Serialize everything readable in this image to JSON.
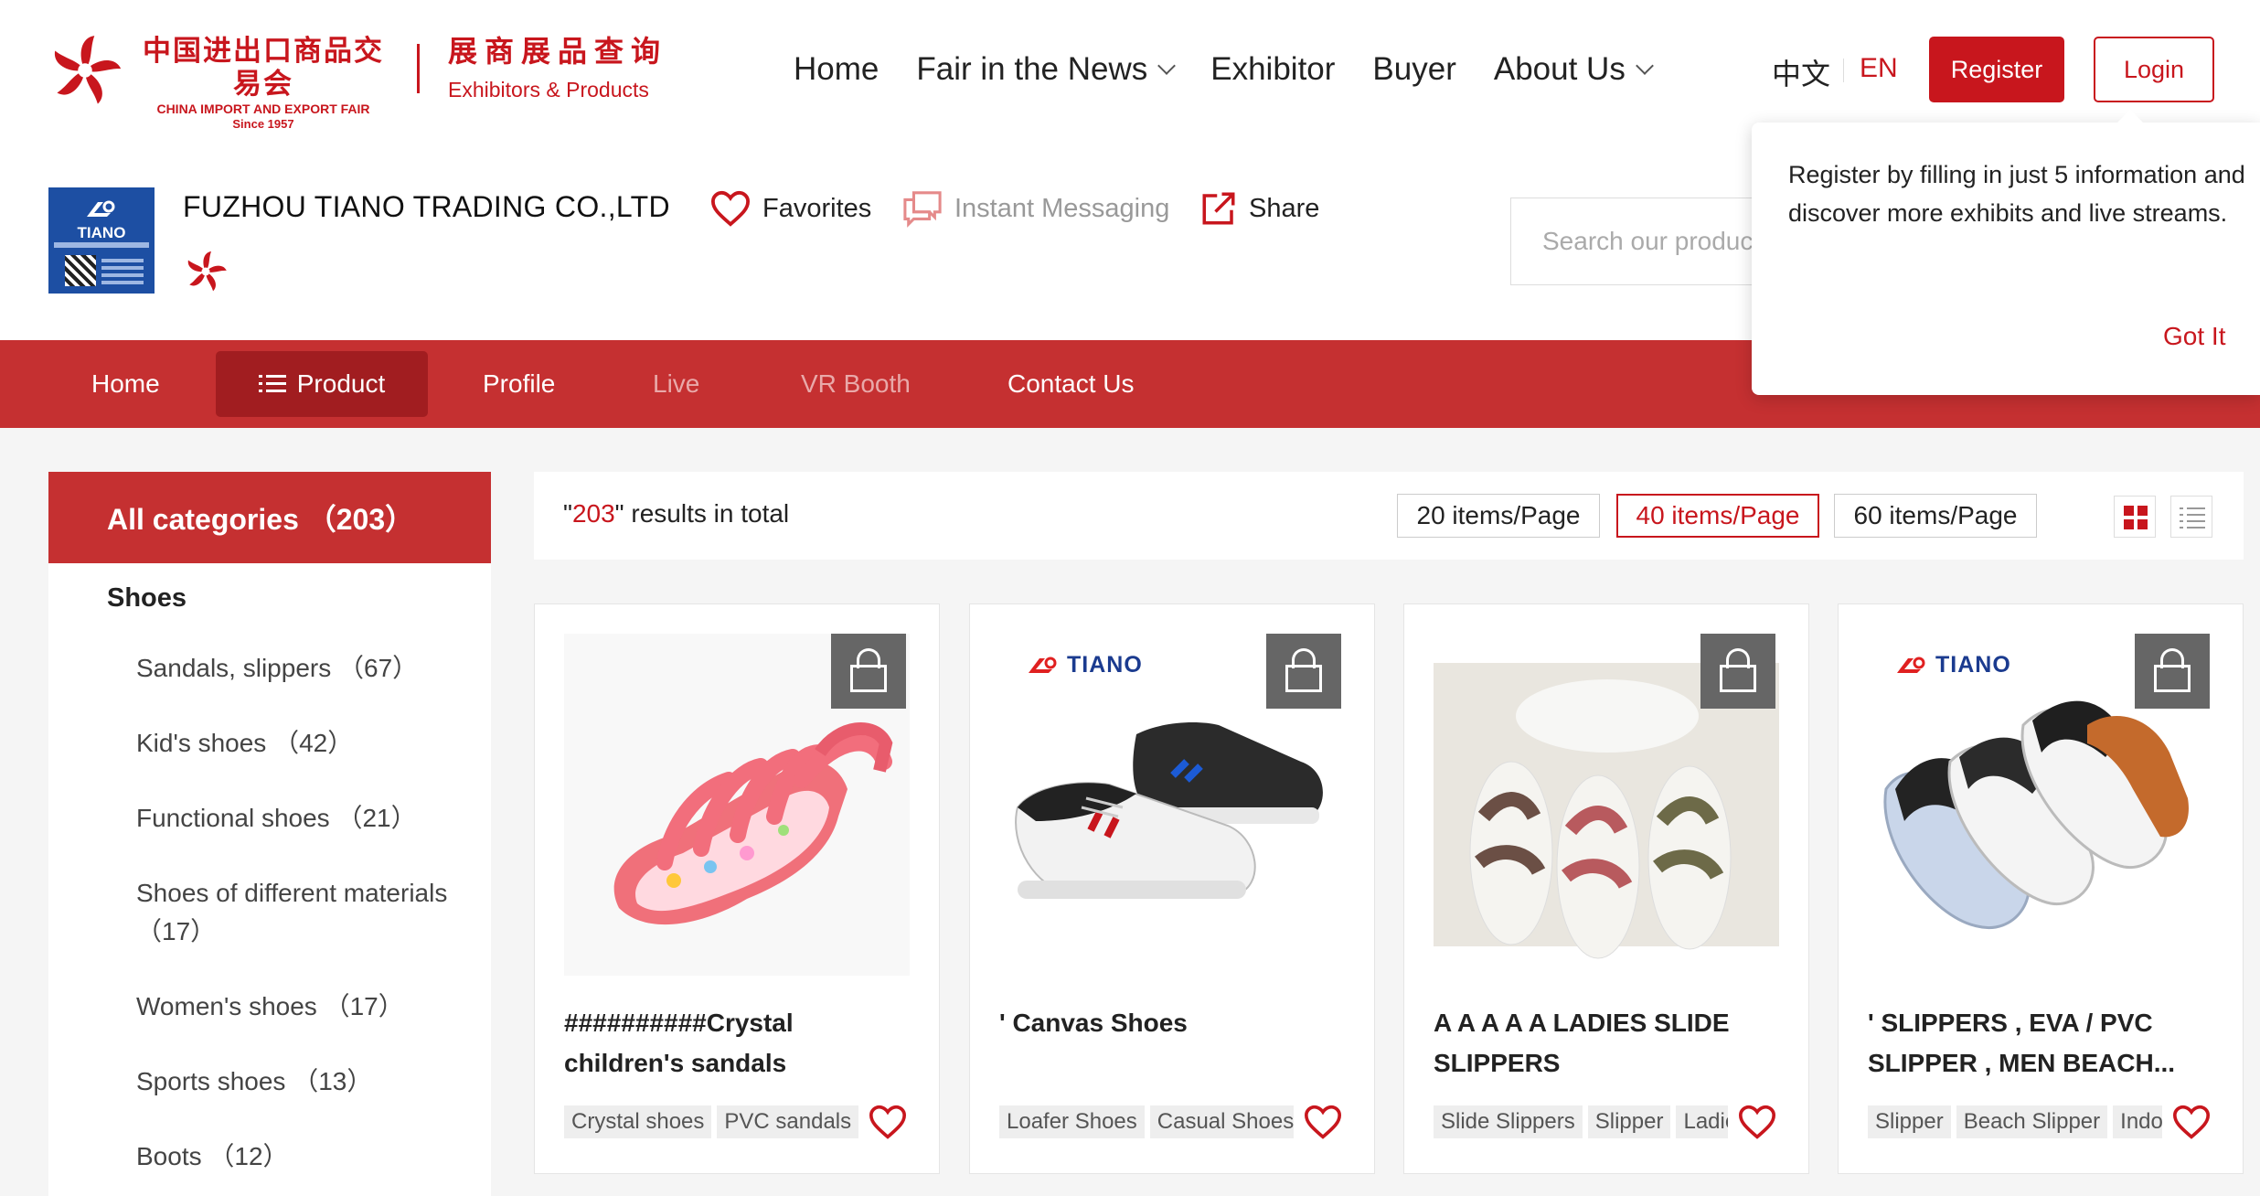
{
  "header": {
    "logo_cn": "中国进出口商品交易会",
    "logo_en": "CHINA IMPORT AND EXPORT FAIR",
    "logo_since": "Since 1957",
    "sub_cn": "展商展品查询",
    "sub_en": "Exhibitors & Products",
    "nav": [
      {
        "label": "Home"
      },
      {
        "label": "Fair in the News",
        "dropdown": true
      },
      {
        "label": "Exhibitor"
      },
      {
        "label": "Buyer"
      },
      {
        "label": "About Us",
        "dropdown": true
      }
    ],
    "lang_zh": "中文",
    "lang_en": "EN",
    "register_label": "Register",
    "login_label": "Login"
  },
  "company": {
    "name": "FUZHOU TIANO TRADING CO.,LTD",
    "logo_text": "TIANO",
    "favorites_label": "Favorites",
    "im_label": "Instant Messaging",
    "share_label": "Share",
    "search_placeholder": "Search our products"
  },
  "store_nav": {
    "items": [
      {
        "label": "Home"
      },
      {
        "label": "Product",
        "active": true
      },
      {
        "label": "Profile"
      },
      {
        "label": "Live",
        "disabled": true
      },
      {
        "label": "VR Booth",
        "disabled": true
      },
      {
        "label": "Contact Us"
      }
    ]
  },
  "popup": {
    "text": "Register by filling in just 5 information and discover more exhibits and live streams.",
    "button": "Got It"
  },
  "sidebar": {
    "header": "All categories （203）",
    "category": "Shoes",
    "items": [
      {
        "label": "Sandals, slippers （67）"
      },
      {
        "label": "Kid's shoes （42）"
      },
      {
        "label": "Functional shoes （21）"
      },
      {
        "label": "Shoes of different materials （17）"
      },
      {
        "label": "Women's shoes （17）"
      },
      {
        "label": "Sports shoes （13）"
      },
      {
        "label": "Boots （12）"
      }
    ]
  },
  "results": {
    "count": "203",
    "prefix": "\"",
    "suffix": "\" results in total",
    "page_sizes": [
      "20 items/Page",
      "40 items/Page",
      "60 items/Page"
    ],
    "active_page_size": "40 items/Page"
  },
  "products": [
    {
      "title": "##########Crystal children's sandals",
      "tags": [
        "Crystal shoes",
        "PVC sandals"
      ],
      "brand_logo": false
    },
    {
      "title": "' Canvas Shoes",
      "tags": [
        "Loafer Shoes",
        "Casual Shoes"
      ],
      "brand_logo": true,
      "brand": "TIANO"
    },
    {
      "title": "A A A A A  LADIES SLIDE SLIPPERS",
      "tags": [
        "Slide Slippers",
        "Slipper",
        "Ladies"
      ],
      "brand_logo": false
    },
    {
      "title": "' SLIPPERS , EVA / PVC SLIPPER , MEN BEACH...",
      "tags": [
        "Slipper",
        "Beach Slipper",
        "Indoor"
      ],
      "brand_logo": true,
      "brand": "TIANO"
    }
  ],
  "colors": {
    "brand_red": "#c8161d",
    "nav_red": "#c53031",
    "nav_active": "#a11d20"
  }
}
